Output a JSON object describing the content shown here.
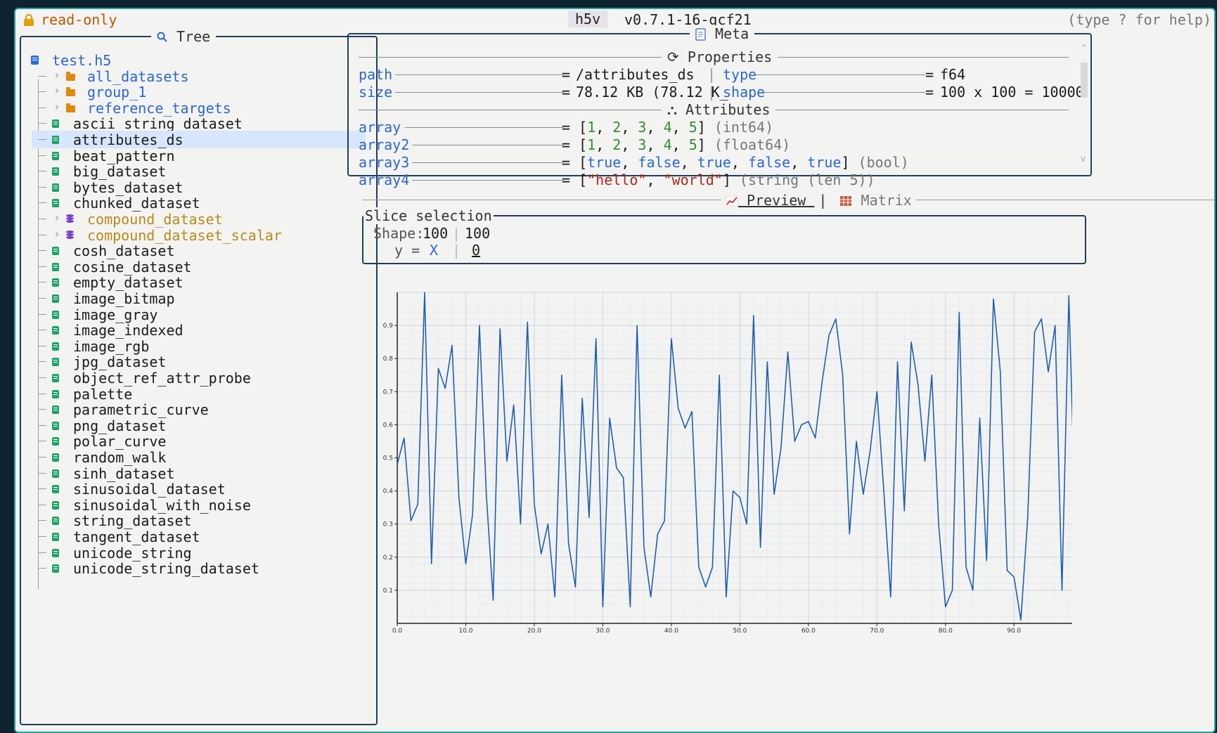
{
  "topbar": {
    "mode": "read-only",
    "app_name": "h5v",
    "version": "v0.7.1-16-gcf21",
    "help": "(type ? for help)"
  },
  "tree": {
    "title": "Tree",
    "root": "test.h5",
    "groups": [
      {
        "label": "all_datasets",
        "kind": "group"
      },
      {
        "label": "group_1",
        "kind": "group"
      },
      {
        "label": "reference_targets",
        "kind": "group"
      }
    ],
    "items": [
      {
        "label": "ascii_string_dataset",
        "kind": "dataset"
      },
      {
        "label": "attributes_ds",
        "kind": "dataset",
        "selected": true
      },
      {
        "label": "beat_pattern",
        "kind": "dataset"
      },
      {
        "label": "big_dataset",
        "kind": "dataset"
      },
      {
        "label": "bytes_dataset",
        "kind": "dataset"
      },
      {
        "label": "chunked_dataset",
        "kind": "dataset"
      },
      {
        "label": "compound_dataset",
        "kind": "compound"
      },
      {
        "label": "compound_dataset_scalar",
        "kind": "compound"
      },
      {
        "label": "cosh_dataset",
        "kind": "dataset"
      },
      {
        "label": "cosine_dataset",
        "kind": "dataset"
      },
      {
        "label": "empty_dataset",
        "kind": "dataset"
      },
      {
        "label": "image_bitmap",
        "kind": "dataset"
      },
      {
        "label": "image_gray",
        "kind": "dataset"
      },
      {
        "label": "image_indexed",
        "kind": "dataset"
      },
      {
        "label": "image_rgb",
        "kind": "dataset"
      },
      {
        "label": "jpg_dataset",
        "kind": "dataset"
      },
      {
        "label": "object_ref_attr_probe",
        "kind": "dataset"
      },
      {
        "label": "palette",
        "kind": "dataset"
      },
      {
        "label": "parametric_curve",
        "kind": "dataset"
      },
      {
        "label": "png_dataset",
        "kind": "dataset"
      },
      {
        "label": "polar_curve",
        "kind": "dataset"
      },
      {
        "label": "random_walk",
        "kind": "dataset"
      },
      {
        "label": "sinh_dataset",
        "kind": "dataset"
      },
      {
        "label": "sinusoidal_dataset",
        "kind": "dataset"
      },
      {
        "label": "sinusoidal_with_noise",
        "kind": "dataset"
      },
      {
        "label": "string_dataset",
        "kind": "dataset"
      },
      {
        "label": "tangent_dataset",
        "kind": "dataset"
      },
      {
        "label": "unicode_string",
        "kind": "dataset"
      },
      {
        "label": "unicode_string_dataset",
        "kind": "dataset"
      }
    ]
  },
  "meta": {
    "title": "Meta",
    "properties_title": "Properties",
    "attributes_title": "Attributes",
    "properties": {
      "path_key": "path",
      "path_val": "/attributes_ds",
      "size_key": "size",
      "size_val": "78.12 KB (78.12 K_",
      "type_key": "type",
      "type_val": "f64",
      "shape_key": "shape",
      "shape_val": "100 x 100 = 10000"
    },
    "attributes": [
      {
        "key": "array",
        "suffix": "(int64)"
      },
      {
        "key": "array2",
        "suffix": "(float64)"
      },
      {
        "key": "array3",
        "suffix": "(bool)"
      },
      {
        "key": "array4",
        "suffix": "(string (len 5))"
      }
    ],
    "eq": "="
  },
  "tabs": {
    "preview": "Preview",
    "separator": "|",
    "matrix": "Matrix"
  },
  "slice": {
    "title": "Slice selection",
    "shape_label": "Shape:",
    "dim0": "100",
    "dim1": "100",
    "y_label": "y =",
    "axis0": "X",
    "axis1": "0"
  },
  "colors": {
    "accent": "#2c67d1",
    "line": "#1f5fb0",
    "border": "#1f3e5c",
    "frame": "#2aa39d"
  },
  "chart_data": {
    "type": "line",
    "xlim": [
      0,
      99
    ],
    "ylim": [
      0,
      1
    ],
    "xticks": [
      "0.0",
      "10.0",
      "20.0",
      "30.0",
      "40.0",
      "50.0",
      "60.0",
      "70.0",
      "80.0",
      "90.0"
    ],
    "yticks": [
      "0.1",
      "0.2",
      "0.3",
      "0.4",
      "0.5",
      "0.6",
      "0.7",
      "0.8",
      "0.9"
    ],
    "grid": true,
    "series": [
      {
        "values": [
          0.48,
          0.56,
          0.31,
          0.36,
          1.0,
          0.18,
          0.77,
          0.71,
          0.84,
          0.38,
          0.18,
          0.33,
          0.9,
          0.39,
          0.07,
          0.89,
          0.49,
          0.66,
          0.3,
          0.91,
          0.36,
          0.21,
          0.3,
          0.08,
          0.75,
          0.24,
          0.11,
          0.68,
          0.32,
          0.86,
          0.05,
          0.62,
          0.47,
          0.44,
          0.05,
          0.9,
          0.23,
          0.08,
          0.27,
          0.31,
          0.86,
          0.65,
          0.59,
          0.64,
          0.17,
          0.11,
          0.17,
          0.75,
          0.08,
          0.4,
          0.38,
          0.3,
          0.93,
          0.23,
          0.79,
          0.39,
          0.53,
          0.82,
          0.55,
          0.6,
          0.61,
          0.56,
          0.73,
          0.87,
          0.92,
          0.75,
          0.27,
          0.55,
          0.39,
          0.52,
          0.7,
          0.4,
          0.08,
          0.79,
          0.34,
          0.85,
          0.72,
          0.49,
          0.75,
          0.3,
          0.05,
          0.1,
          0.94,
          0.17,
          0.1,
          0.62,
          0.19,
          0.98,
          0.76,
          0.16,
          0.14,
          0.01,
          0.32,
          0.88,
          0.92,
          0.76,
          0.9,
          0.1,
          0.99,
          0.28
        ]
      }
    ]
  }
}
